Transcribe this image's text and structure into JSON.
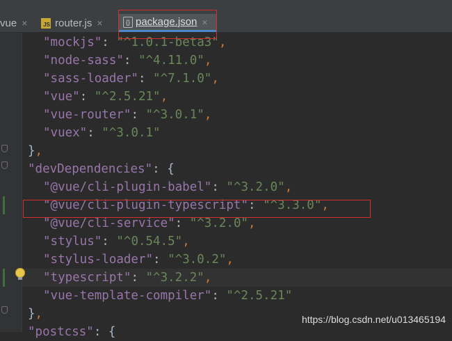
{
  "tabs": [
    {
      "label": "vue",
      "close": "×"
    },
    {
      "label": "router.js",
      "close": "×",
      "icon_text": "JS"
    },
    {
      "label": "package.json",
      "close": "×",
      "icon_text": "{}"
    }
  ],
  "code": {
    "mockjs": {
      "key": "\"mockjs\"",
      "colon": ": ",
      "value": "\"^1.0.1-beta3\"",
      "comma": ","
    },
    "node_sass": {
      "key": "\"node-sass\"",
      "colon": ": ",
      "value": "\"^4.11.0\"",
      "comma": ","
    },
    "sass_loader": {
      "key": "\"sass-loader\"",
      "colon": ": ",
      "value": "\"^7.1.0\"",
      "comma": ","
    },
    "vue": {
      "key": "\"vue\"",
      "colon": ": ",
      "value": "\"^2.5.21\"",
      "comma": ","
    },
    "vue_router": {
      "key": "\"vue-router\"",
      "colon": ": ",
      "value": "\"^3.0.1\"",
      "comma": ","
    },
    "vuex": {
      "key": "\"vuex\"",
      "colon": ": ",
      "value": "\"^3.0.1\""
    },
    "close_deps": {
      "brace": "}",
      "comma": ","
    },
    "dev_deps": {
      "key": "\"devDependencies\"",
      "colon": ": ",
      "brace": "{"
    },
    "cli_babel": {
      "key": "\"@vue/cli-plugin-babel\"",
      "colon": ": ",
      "value": "\"^3.2.0\"",
      "comma": ","
    },
    "cli_typescript": {
      "key": "\"@vue/cli-plugin-typescript\"",
      "colon": ": ",
      "value": "\"^3.3.0\"",
      "comma": ","
    },
    "cli_service": {
      "key": "\"@vue/cli-service\"",
      "colon": ": ",
      "value": "\"^3.2.0\"",
      "comma": ","
    },
    "stylus": {
      "key": "\"stylus\"",
      "colon": ": ",
      "value": "\"^0.54.5\"",
      "comma": ","
    },
    "stylus_loader": {
      "key": "\"stylus-loader\"",
      "colon": ": ",
      "value": "\"^3.0.2\"",
      "comma": ","
    },
    "typescript": {
      "key": "\"typescript\"",
      "colon": ": ",
      "value": "\"^3.2.2\"",
      "comma": ","
    },
    "vue_template_compiler": {
      "key": "\"vue-template-compiler\"",
      "colon": ": ",
      "value": "\"^2.5.21\""
    },
    "close_dev": {
      "brace": "}",
      "comma": ","
    },
    "postcss": {
      "key": "\"postcss\"",
      "colon": ": ",
      "brace": "{"
    }
  },
  "watermark": "https://blog.csdn.net/u013465194",
  "colors": {
    "background": "#2b2b2b",
    "key": "#9876aa",
    "string": "#6a8759",
    "punctuation": "#cc7832",
    "bracket": "#a9b7c6",
    "annotation_box": "#d32f2f",
    "active_tab_underline": "#4a88c7"
  },
  "icons": [
    "js-file-icon",
    "json-file-icon",
    "close-icon",
    "intention-bulb-icon",
    "fold-marker-icon"
  ]
}
